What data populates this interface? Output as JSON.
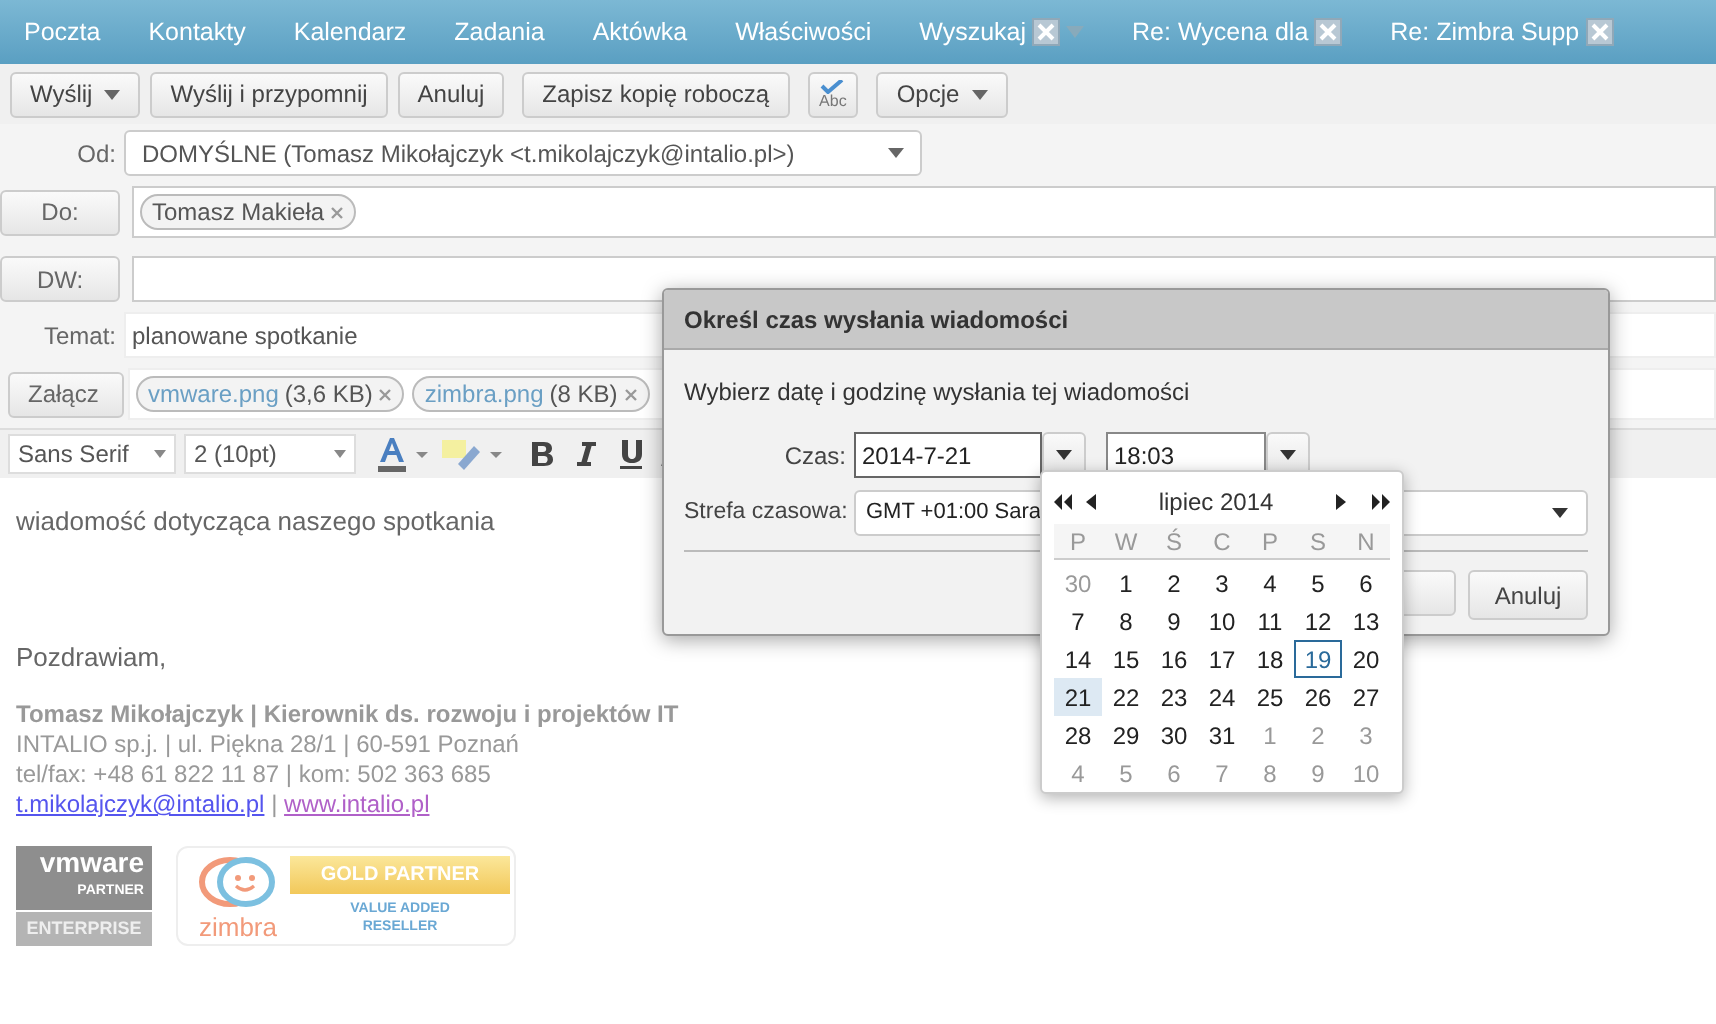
{
  "app_tabs": [
    {
      "label": "Poczta",
      "closable": false,
      "menu": false
    },
    {
      "label": "Kontakty",
      "closable": false,
      "menu": false
    },
    {
      "label": "Kalendarz",
      "closable": false,
      "menu": false
    },
    {
      "label": "Zadania",
      "closable": false,
      "menu": false
    },
    {
      "label": "Aktówka",
      "closable": false,
      "menu": false
    },
    {
      "label": "Właściwości",
      "closable": false,
      "menu": false
    },
    {
      "label": "Wyszukaj",
      "closable": true,
      "menu": true
    },
    {
      "label": "Re: Wycena dla",
      "closable": true,
      "menu": false
    },
    {
      "label": "Re: Zimbra Supp",
      "closable": true,
      "menu": false
    }
  ],
  "toolbar": [
    {
      "label": "Wyślij",
      "kind": "dropdown"
    },
    {
      "label": "Wyślij i przypomnij",
      "kind": "plain"
    },
    {
      "label": "Anuluj",
      "kind": "plain"
    },
    {
      "label": "Zapisz kopię roboczą",
      "kind": "plain"
    },
    {
      "label": "Abc",
      "kind": "spellcheck"
    },
    {
      "label": "Opcje",
      "kind": "dropdown"
    }
  ],
  "compose": {
    "from": {
      "label": "Od:",
      "value": "DOMYŚLNE (Tomasz Mikołajczyk <t.mikolajczyk@intalio.pl>)"
    },
    "to": {
      "label": "Do:",
      "recipients": [
        "Tomasz Makieła"
      ]
    },
    "cc": {
      "label": "DW:"
    },
    "subject": {
      "label": "Temat:",
      "value": "planowane spotkanie"
    },
    "attach": {
      "label": "Załącz",
      "files": [
        {
          "name": "vmware.png",
          "size": "(3,6 KB)"
        },
        {
          "name": "zimbra.png",
          "size": "(8 KB)"
        }
      ]
    }
  },
  "editor_toolbar": {
    "font": "Sans Serif",
    "size": "2 (10pt)"
  },
  "body": {
    "message": "wiadomość dotycząca naszego spotkania",
    "greeting": "Pozdrawiam,",
    "signature": {
      "name_line": "Tomasz Mikołajczyk | Kierownik ds. rozwoju i projektów IT",
      "address": "INTALIO sp.j. | ul. Piękna 28/1 | 60-591 Poznań",
      "phone": "tel/fax: +48 61 822 11 87 | kom: 502 363 685",
      "email": "t.mikolajczyk@intalio.pl",
      "separator": "|",
      "website": "www.intalio.pl"
    },
    "logos": [
      {
        "kind": "vmware",
        "texts": [
          "vmware",
          "PARTNER",
          "ENTERPRISE"
        ]
      },
      {
        "kind": "zimbra",
        "texts": [
          "zimbra",
          "GOLD PARTNER",
          "VALUE ADDED",
          "RESELLER"
        ]
      }
    ]
  },
  "dialog": {
    "title": "Określ czas wysłania wiadomości",
    "prompt": "Wybierz datę i godzinę wysłania tej wiadomości",
    "time_label": "Czas:",
    "date": "2014-7-21",
    "time": "18:03",
    "zone_label": "Strefa czasowa:",
    "zone": "GMT +01:00 Sara",
    "cancel": "Anuluj"
  },
  "calendar": {
    "month": "lipiec 2014",
    "weekdays": [
      "P",
      "W",
      "Ś",
      "C",
      "P",
      "S",
      "N"
    ],
    "weeks": [
      [
        {
          "d": "30",
          "other": true,
          "today": false,
          "selected": false
        },
        {
          "d": "1",
          "other": false,
          "today": false,
          "selected": false
        },
        {
          "d": "2",
          "other": false,
          "today": false,
          "selected": false
        },
        {
          "d": "3",
          "other": false,
          "today": false,
          "selected": false
        },
        {
          "d": "4",
          "other": false,
          "today": false,
          "selected": false
        },
        {
          "d": "5",
          "other": false,
          "today": false,
          "selected": false
        },
        {
          "d": "6",
          "other": false,
          "today": false,
          "selected": false
        }
      ],
      [
        {
          "d": "7",
          "other": false,
          "today": false,
          "selected": false
        },
        {
          "d": "8",
          "other": false,
          "today": false,
          "selected": false
        },
        {
          "d": "9",
          "other": false,
          "today": false,
          "selected": false
        },
        {
          "d": "10",
          "other": false,
          "today": false,
          "selected": false
        },
        {
          "d": "11",
          "other": false,
          "today": false,
          "selected": false
        },
        {
          "d": "12",
          "other": false,
          "today": false,
          "selected": false
        },
        {
          "d": "13",
          "other": false,
          "today": false,
          "selected": false
        }
      ],
      [
        {
          "d": "14",
          "other": false,
          "today": false,
          "selected": false
        },
        {
          "d": "15",
          "other": false,
          "today": false,
          "selected": false
        },
        {
          "d": "16",
          "other": false,
          "today": false,
          "selected": false
        },
        {
          "d": "17",
          "other": false,
          "today": false,
          "selected": false
        },
        {
          "d": "18",
          "other": false,
          "today": false,
          "selected": false
        },
        {
          "d": "19",
          "other": false,
          "today": true,
          "selected": false
        },
        {
          "d": "20",
          "other": false,
          "today": false,
          "selected": false
        }
      ],
      [
        {
          "d": "21",
          "other": false,
          "today": false,
          "selected": true
        },
        {
          "d": "22",
          "other": false,
          "today": false,
          "selected": false
        },
        {
          "d": "23",
          "other": false,
          "today": false,
          "selected": false
        },
        {
          "d": "24",
          "other": false,
          "today": false,
          "selected": false
        },
        {
          "d": "25",
          "other": false,
          "today": false,
          "selected": false
        },
        {
          "d": "26",
          "other": false,
          "today": false,
          "selected": false
        },
        {
          "d": "27",
          "other": false,
          "today": false,
          "selected": false
        }
      ],
      [
        {
          "d": "28",
          "other": false,
          "today": false,
          "selected": false
        },
        {
          "d": "29",
          "other": false,
          "today": false,
          "selected": false
        },
        {
          "d": "30",
          "other": false,
          "today": false,
          "selected": false
        },
        {
          "d": "31",
          "other": false,
          "today": false,
          "selected": false
        },
        {
          "d": "1",
          "other": true,
          "today": false,
          "selected": false
        },
        {
          "d": "2",
          "other": true,
          "today": false,
          "selected": false
        },
        {
          "d": "3",
          "other": true,
          "today": false,
          "selected": false
        }
      ],
      [
        {
          "d": "4",
          "other": true,
          "today": false,
          "selected": false
        },
        {
          "d": "5",
          "other": true,
          "today": false,
          "selected": false
        },
        {
          "d": "6",
          "other": true,
          "today": false,
          "selected": false
        },
        {
          "d": "7",
          "other": true,
          "today": false,
          "selected": false
        },
        {
          "d": "8",
          "other": true,
          "today": false,
          "selected": false
        },
        {
          "d": "9",
          "other": true,
          "today": false,
          "selected": false
        },
        {
          "d": "10",
          "other": true,
          "today": false,
          "selected": false
        }
      ]
    ]
  }
}
